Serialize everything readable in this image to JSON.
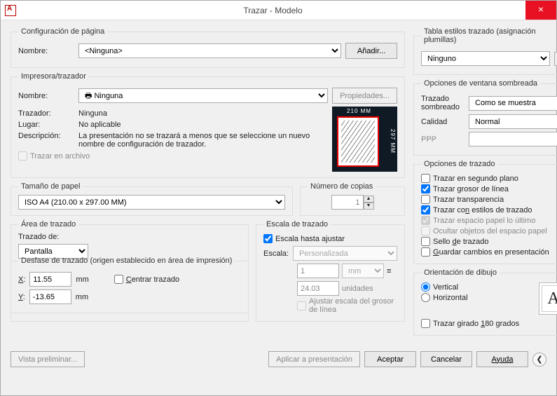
{
  "title": "Trazar - Modelo",
  "page_config": {
    "legend": "Configuración de página",
    "name_label": "Nombre:",
    "name_value": "<Ninguna>",
    "add_button": "Añadir..."
  },
  "printer": {
    "legend": "Impresora/trazador",
    "name_label": "Nombre:",
    "name_value": "Ninguna",
    "props_button": "Propiedades...",
    "plotter_label": "Trazador:",
    "plotter_value": "Ninguna",
    "location_label": "Lugar:",
    "location_value": "No aplicable",
    "desc_label": "Descripción:",
    "desc_value": "La presentación no se trazará a menos que se seleccione un nuevo nombre de configuración de trazador.",
    "to_file_label": "Trazar en archivo",
    "preview_top": "210 MM",
    "preview_right": "297 MM"
  },
  "papersize": {
    "legend": "Tamaño de papel",
    "value": "ISO A4 (210.00 x 297.00 MM)"
  },
  "copies": {
    "legend": "Número de copias",
    "value": "1"
  },
  "plotarea": {
    "legend": "Área de trazado",
    "label": "Trazado de:",
    "value": "Pantalla"
  },
  "scale": {
    "legend": "Escala de trazado",
    "fit_label": "Escala hasta ajustar",
    "scale_label": "Escala:",
    "scale_value": "Personalizada",
    "num": "1",
    "unit": "mm",
    "den": "24.03",
    "den_unit": "unidades",
    "lw_label": "Ajustar escala del grosor de línea"
  },
  "offset": {
    "legend": "Desfase de trazado (origen establecido en área de impresión)",
    "x_label": "X:",
    "x_value": "11.55",
    "y_label": "Y:",
    "y_value": "-13.65",
    "unit": "mm",
    "center_label": "Centrar trazado"
  },
  "styletable": {
    "legend": "Tabla estilos trazado (asignación plumillas)",
    "value": "Ninguno"
  },
  "shaded": {
    "legend": "Opciones de ventana sombreada",
    "shade_label": "Trazado sombreado",
    "shade_value": "Como se muestra",
    "quality_label": "Calidad",
    "quality_value": "Normal",
    "ppp_label": "PPP",
    "ppp_value": ""
  },
  "options": {
    "legend": "Opciones de trazado",
    "bg": "Trazar en segundo plano",
    "lw": "Trazar grosor de línea",
    "trans": "Trazar transparencia",
    "styles": "Trazar con estilos de trazado",
    "paper_last": "Trazar espacio papel lo último",
    "hide_paper": "Ocultar objetos del espacio papel",
    "stamp": "Sello de trazado",
    "save": "Guardar cambios en presentación"
  },
  "orientation": {
    "legend": "Orientación de dibujo",
    "portrait": "Vertical",
    "landscape": "Horizontal",
    "upside": "Trazar girado 180 grados",
    "glyph": "A"
  },
  "footer": {
    "preview": "Vista preliminar...",
    "apply": "Aplicar a presentación",
    "ok": "Aceptar",
    "cancel": "Cancelar",
    "help": "Ayuda"
  }
}
